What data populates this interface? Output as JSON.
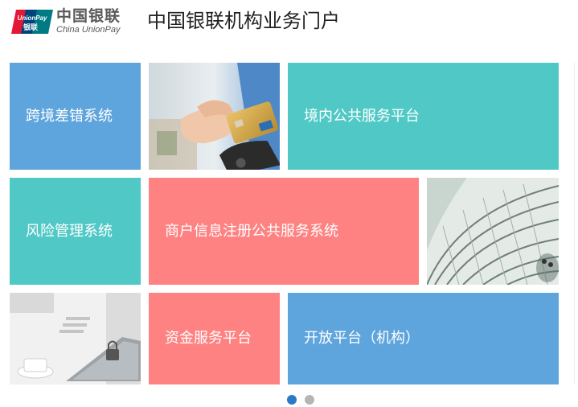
{
  "header": {
    "logo_mark_text": "UnionPay 银联",
    "logo_cn": "中国银联",
    "logo_en": "China UnionPay",
    "title": "中国银联机构业务门户"
  },
  "tiles": [
    {
      "label": "跨境差错系统",
      "color": "#5fa5dd"
    },
    {
      "label": "境内公共服务平台",
      "color": "#50c9c6"
    },
    {
      "label": "风险管理系统",
      "color": "#50c9c6"
    },
    {
      "label": "商户信息注册公共服务系统",
      "color": "#fe8282"
    },
    {
      "label": "资金服务平台",
      "color": "#fe8282"
    },
    {
      "label": "开放平台（机构）",
      "color": "#5fa5dd"
    }
  ],
  "photos": [
    {
      "icon": "card-payment-photo"
    },
    {
      "icon": "architecture-photo"
    },
    {
      "icon": "laptop-lock-photo"
    }
  ],
  "pager": {
    "total_pages": 2,
    "current_page": 1,
    "active_color": "#2b79c7",
    "inactive_color": "#b5b5b5"
  }
}
